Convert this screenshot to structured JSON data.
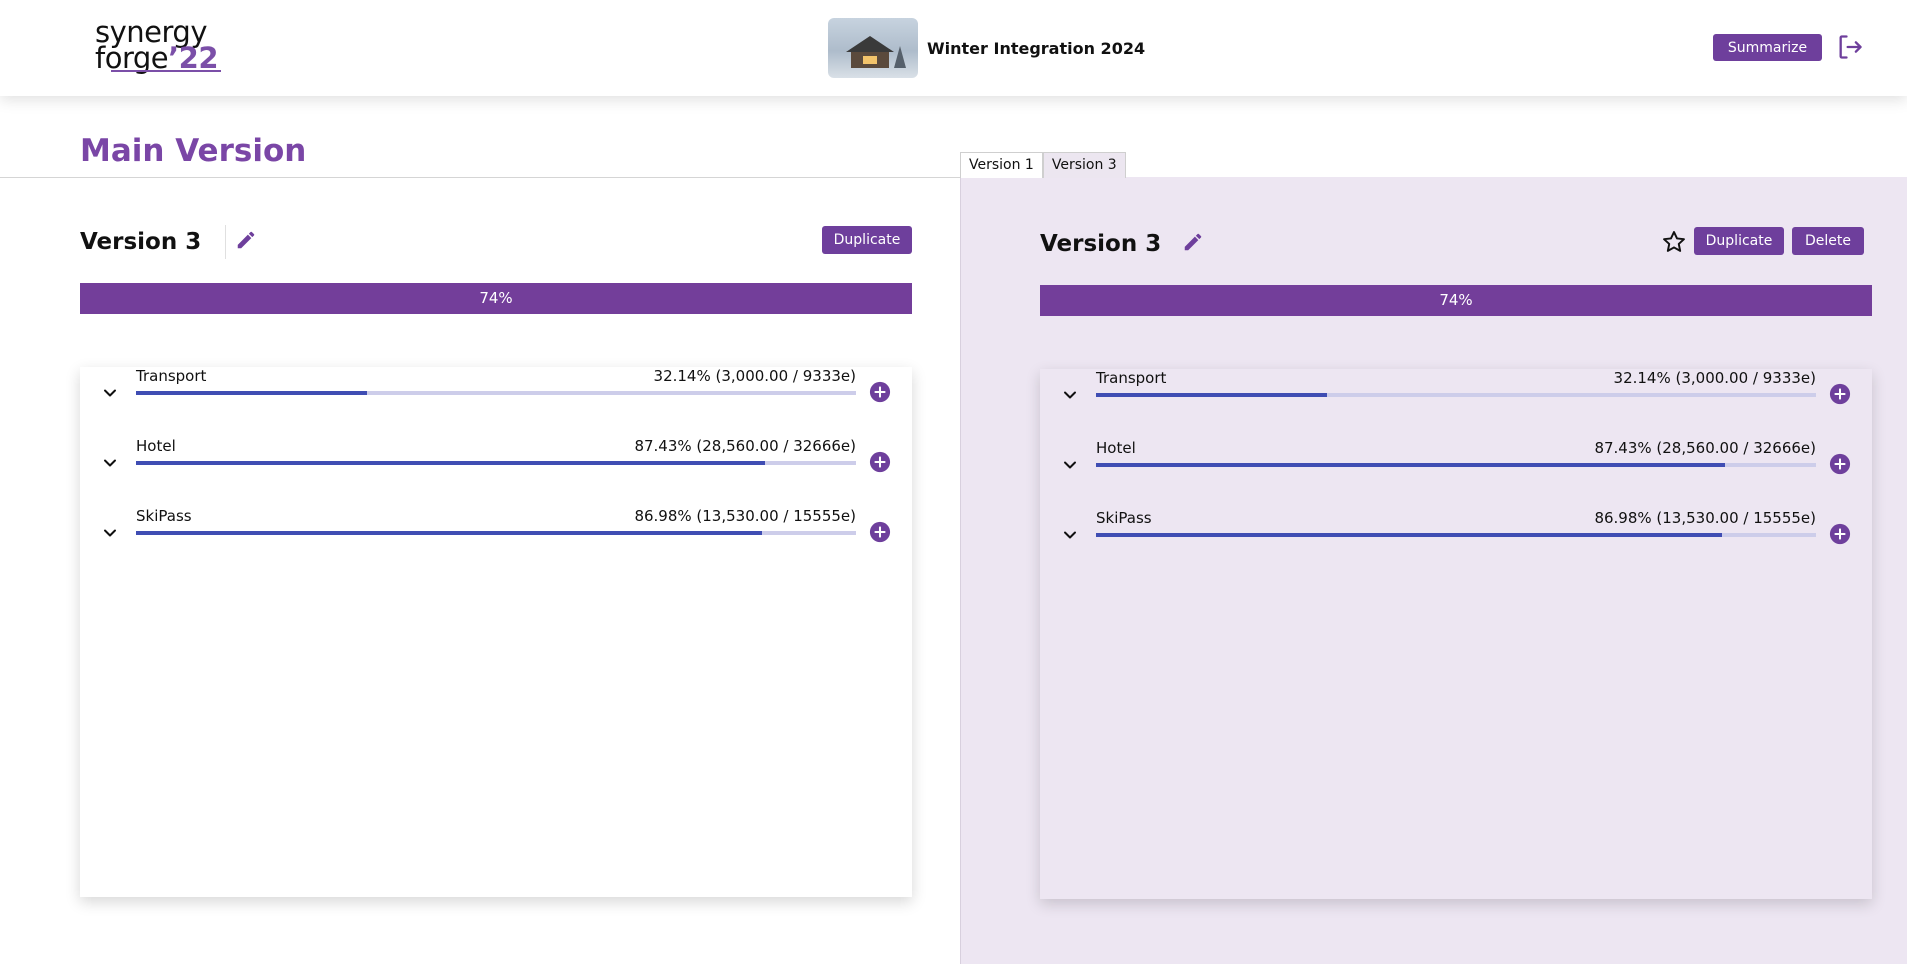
{
  "header": {
    "logo": {
      "line1": "synergy",
      "line2a": "forge",
      "line2b": "’22"
    },
    "event_title": "Winter Integration 2024",
    "summarize_label": "Summarize"
  },
  "main": {
    "title": "Main Version",
    "tabs": [
      {
        "label": "Version 1"
      },
      {
        "label": "Version 3"
      }
    ]
  },
  "left_version": {
    "title": "Version 3",
    "duplicate_label": "Duplicate",
    "progress_label": "74%",
    "progress_value": 0.74,
    "items": [
      {
        "name": "Transport",
        "stat": "32.14% (3,000.00 / 9333e)",
        "fill": 0.3214
      },
      {
        "name": "Hotel",
        "stat": "87.43% (28,560.00 / 32666e)",
        "fill": 0.8743
      },
      {
        "name": "SkiPass",
        "stat": "86.98% (13,530.00 / 15555e)",
        "fill": 0.8698
      }
    ]
  },
  "right_version": {
    "title": "Version 3",
    "duplicate_label": "Duplicate",
    "delete_label": "Delete",
    "progress_label": "74%",
    "progress_value": 0.74,
    "items": [
      {
        "name": "Transport",
        "stat": "32.14% (3,000.00 / 9333e)",
        "fill": 0.3214
      },
      {
        "name": "Hotel",
        "stat": "87.43% (28,560.00 / 32666e)",
        "fill": 0.8743
      },
      {
        "name": "SkiPass",
        "stat": "86.98% (13,530.00 / 15555e)",
        "fill": 0.8698
      }
    ]
  },
  "colors": {
    "accent": "#6e3f9c",
    "progress_bar": "#733e9a",
    "item_fill": "#3f4db3",
    "item_track": "#cdcdea",
    "right_panel_bg": "#ede6f2"
  }
}
